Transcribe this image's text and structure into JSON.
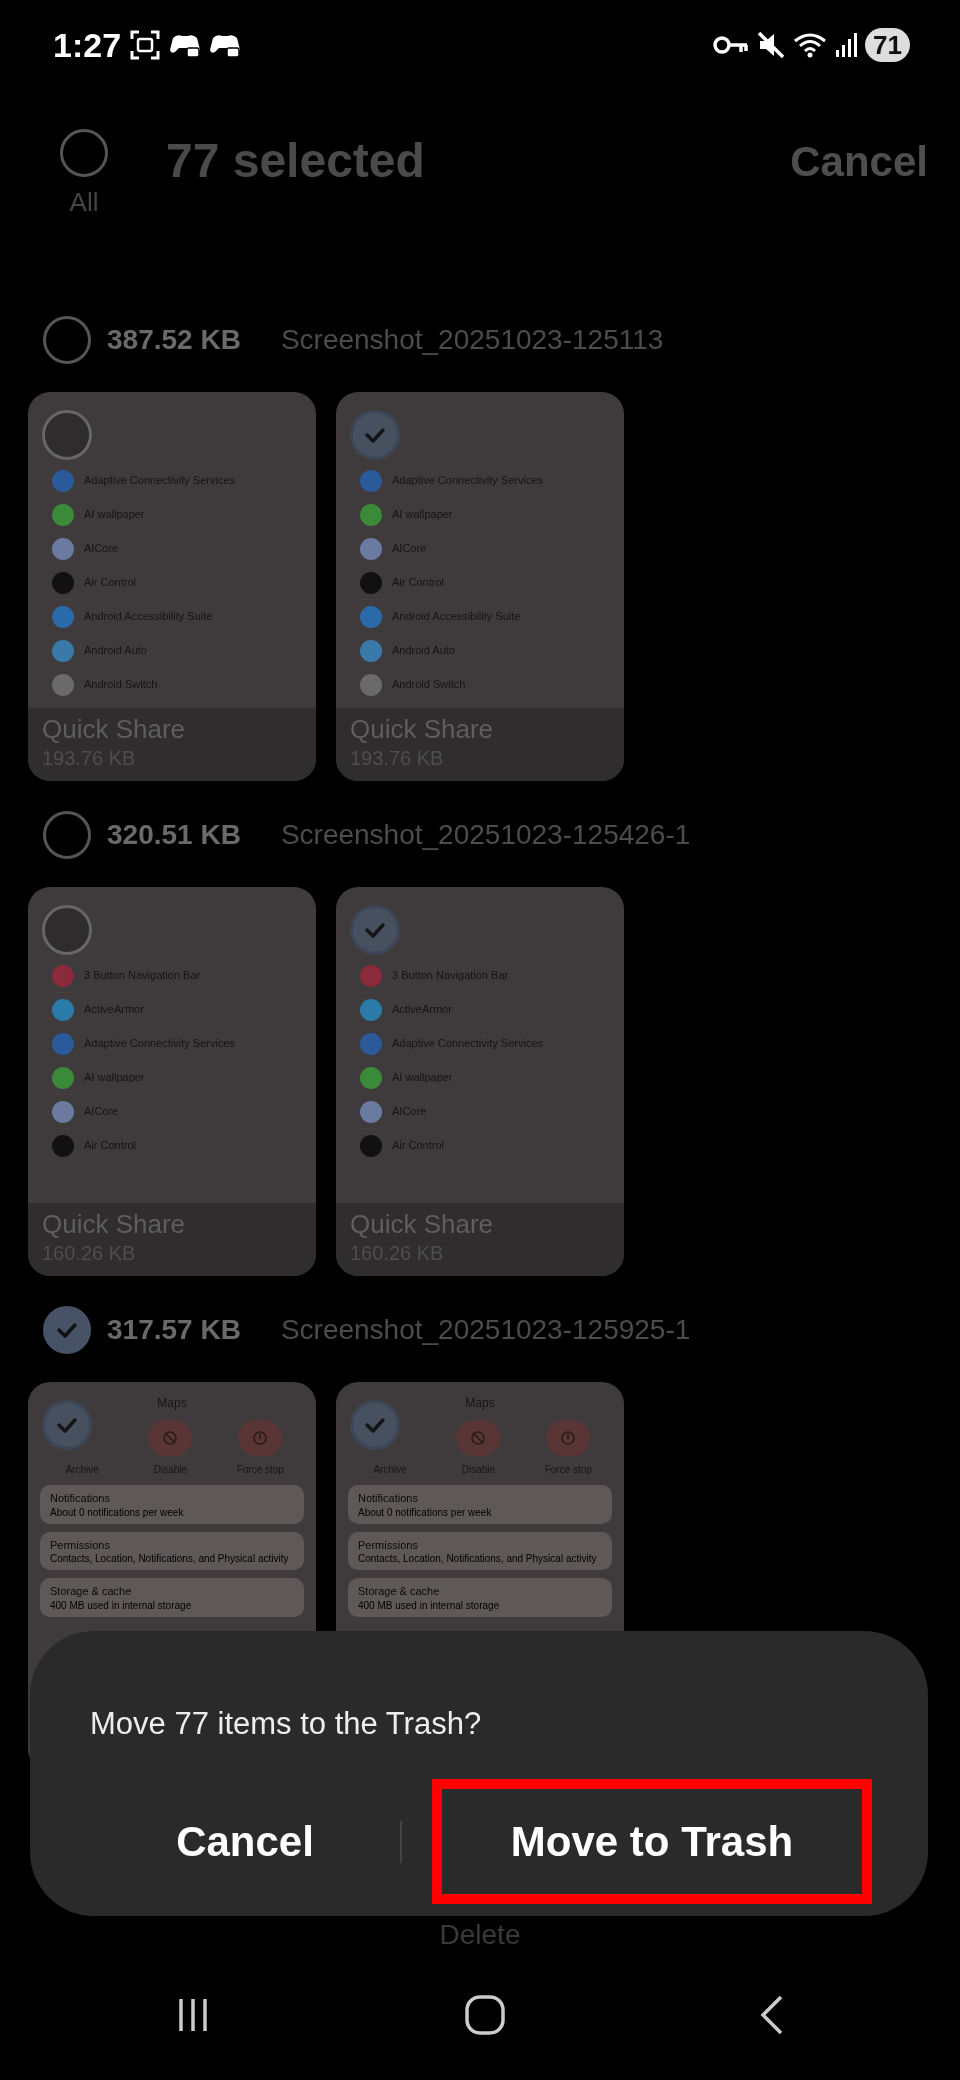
{
  "status_bar": {
    "time": "1:27",
    "battery": "71"
  },
  "header": {
    "all_label": "All",
    "all_checked": false,
    "title": "77 selected",
    "cancel": "Cancel"
  },
  "groups": [
    {
      "size": "387.52 KB",
      "name": "Screenshot_20251023-125113",
      "checked": false,
      "items": [
        {
          "checked": false,
          "caption": "Quick Share",
          "size": "193.76 KB",
          "preview": {
            "kind": "app_list",
            "apps": [
              {
                "name": "Adaptive Connectivity Services",
                "color": "#2a5a9a"
              },
              {
                "name": "AI wallpaper",
                "color": "#3a8a3a"
              },
              {
                "name": "AICore",
                "color": "#6a7aa0"
              },
              {
                "name": "Air Control",
                "color": "#111111"
              },
              {
                "name": "Android Accessibility Suite",
                "color": "#2a6aaa"
              },
              {
                "name": "Android Auto",
                "color": "#3a7aaa"
              },
              {
                "name": "Android Switch",
                "color": "#6a6a6a"
              }
            ]
          }
        },
        {
          "checked": true,
          "caption": "Quick Share",
          "size": "193.76 KB",
          "preview": {
            "kind": "app_list",
            "apps": [
              {
                "name": "Adaptive Connectivity Services",
                "color": "#2a5a9a"
              },
              {
                "name": "AI wallpaper",
                "color": "#3a8a3a"
              },
              {
                "name": "AICore",
                "color": "#6a7aa0"
              },
              {
                "name": "Air Control",
                "color": "#111111"
              },
              {
                "name": "Android Accessibility Suite",
                "color": "#2a6aaa"
              },
              {
                "name": "Android Auto",
                "color": "#3a7aaa"
              },
              {
                "name": "Android Switch",
                "color": "#6a6a6a"
              }
            ]
          }
        }
      ]
    },
    {
      "size": "320.51 KB",
      "name": "Screenshot_20251023-125426-1",
      "checked": false,
      "items": [
        {
          "checked": false,
          "caption": "Quick Share",
          "size": "160.26 KB",
          "preview": {
            "kind": "app_list",
            "apps": [
              {
                "name": "3 Button Navigation Bar",
                "color": "#8a2a3a"
              },
              {
                "name": "ActiveArmor",
                "color": "#2a7aaa"
              },
              {
                "name": "Adaptive Connectivity Services",
                "color": "#2a5a9a"
              },
              {
                "name": "AI wallpaper",
                "color": "#3a8a3a"
              },
              {
                "name": "AICore",
                "color": "#6a7aa0"
              },
              {
                "name": "Air Control",
                "color": "#111111"
              }
            ]
          }
        },
        {
          "checked": true,
          "caption": "Quick Share",
          "size": "160.26 KB",
          "preview": {
            "kind": "app_list",
            "apps": [
              {
                "name": "3 Button Navigation Bar",
                "color": "#8a2a3a"
              },
              {
                "name": "ActiveArmor",
                "color": "#2a7aaa"
              },
              {
                "name": "Adaptive Connectivity Services",
                "color": "#2a5a9a"
              },
              {
                "name": "AI wallpaper",
                "color": "#3a8a3a"
              },
              {
                "name": "AICore",
                "color": "#6a7aa0"
              },
              {
                "name": "Air Control",
                "color": "#111111"
              }
            ]
          }
        }
      ]
    },
    {
      "size": "317.57 KB",
      "name": "Screenshot_20251023-125925-1",
      "checked": true,
      "items": [
        {
          "checked": true,
          "preview": {
            "kind": "app_info",
            "title": "Maps",
            "actions": [
              "Archive",
              "Disable",
              "Force stop"
            ],
            "rows": [
              {
                "title": "Notifications",
                "subtitle": "About 0 notifications per week"
              },
              {
                "title": "Permissions",
                "subtitle": "Contacts, Location, Notifications, and Physical activity"
              },
              {
                "title": "Storage & cache",
                "subtitle": "400 MB used in internal storage"
              }
            ]
          }
        },
        {
          "checked": true,
          "preview": {
            "kind": "app_info",
            "title": "Maps",
            "actions": [
              "Archive",
              "Disable",
              "Force stop"
            ],
            "rows": [
              {
                "title": "Notifications",
                "subtitle": "About 0 notifications per week"
              },
              {
                "title": "Permissions",
                "subtitle": "Contacts, Location, Notifications, and Physical activity"
              },
              {
                "title": "Storage & cache",
                "subtitle": "400 MB used in internal storage"
              }
            ]
          }
        }
      ]
    }
  ],
  "bottom_bar": {
    "label": "Delete"
  },
  "dialog": {
    "message": "Move 77 items to the Trash?",
    "buttons": [
      {
        "label": "Cancel",
        "highlighted": false
      },
      {
        "label": "Move to Trash",
        "highlighted": true
      }
    ]
  }
}
